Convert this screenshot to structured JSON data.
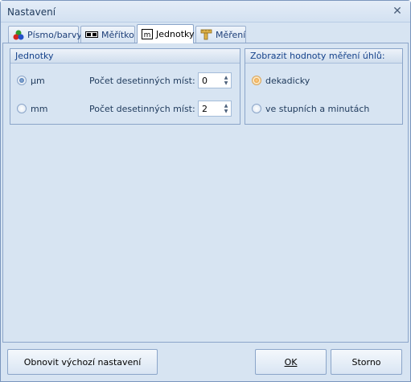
{
  "window": {
    "title": "Nastavení",
    "close_glyph": "✕"
  },
  "tabs": [
    {
      "label": "Písmo/barvy",
      "icon": "color-dots-icon"
    },
    {
      "label": "Měřítko",
      "icon": "scale-bar-icon"
    },
    {
      "label": "Jednotky",
      "icon": "units-m-icon",
      "active": true
    },
    {
      "label": "Měření",
      "icon": "ruler-icon"
    }
  ],
  "units_group": {
    "title": "Jednotky",
    "options": [
      {
        "label": "μm",
        "checked": true,
        "decimals_label": "Počet desetinných míst:",
        "decimals_value": "0"
      },
      {
        "label": "mm",
        "checked": false,
        "decimals_label": "Počet desetinných míst:",
        "decimals_value": "2"
      }
    ]
  },
  "angle_group": {
    "title": "Zobrazit hodnoty měření úhlů:",
    "options": [
      {
        "label": "dekadicky",
        "checked": true
      },
      {
        "label": "ve stupních a minutách",
        "checked": false
      }
    ]
  },
  "footer": {
    "reset_label": "Obnovit výchozí nastavení",
    "ok_label": "OK",
    "cancel_label": "Storno"
  },
  "colors": {
    "accent": "#15428b",
    "frame": "#d7e4f2",
    "border": "#8ba5c9"
  }
}
